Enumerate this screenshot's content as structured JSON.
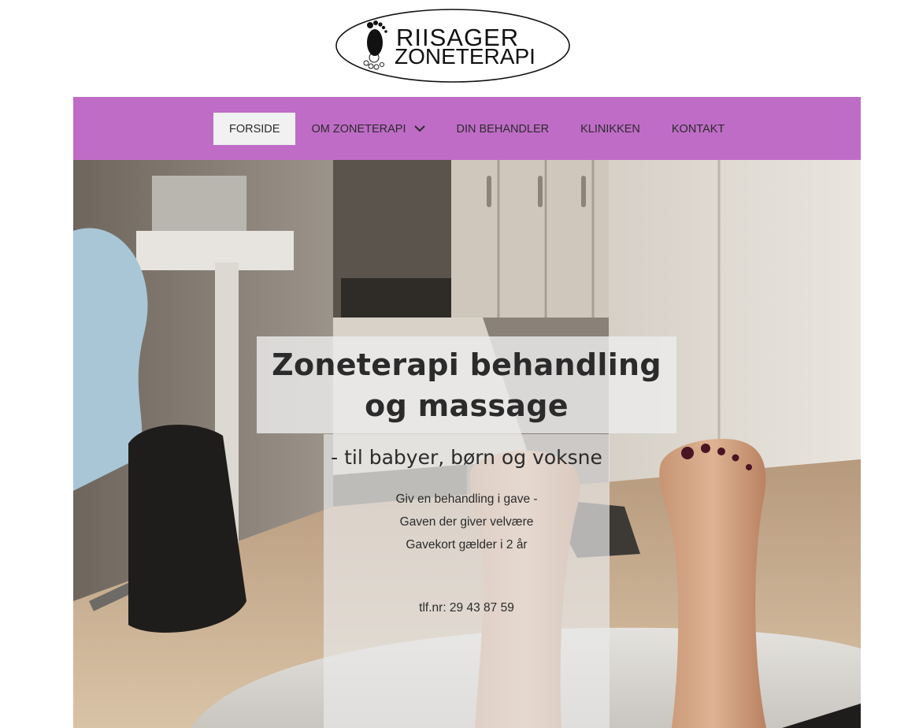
{
  "logo": {
    "line1": "RIISAGER",
    "line2": "ZONETERAPI",
    "foot_icon": "foot-icon"
  },
  "nav": {
    "items": [
      {
        "label": "FORSIDE",
        "active": true
      },
      {
        "label": "OM ZONETERAPI",
        "has_dropdown": true
      },
      {
        "label": "DIN BEHANDLER"
      },
      {
        "label": "KLINIKKEN"
      },
      {
        "label": "KONTAKT"
      }
    ],
    "dropdown_icon": "chevron-down-icon"
  },
  "hero": {
    "title": "Zoneterapi behandling og massage",
    "subtitle": "- til babyer, børn og voksne",
    "lines": [
      "Giv en behandling i gave -",
      "Gaven der giver velvære",
      "Gavekort gælder i 2 år"
    ],
    "phone": "tlf.nr: 29 43 87 59",
    "image": "feet-on-footrest-photo"
  },
  "colors": {
    "nav_bg": "#bf6cc7",
    "active_item_bg": "#f1f1f1",
    "text": "#2b2b2b"
  }
}
